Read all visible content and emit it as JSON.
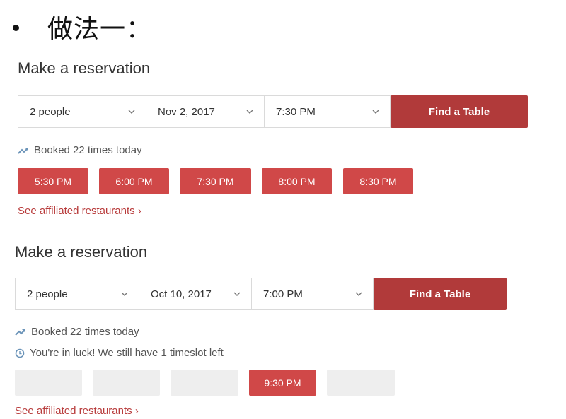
{
  "bullet": {
    "text": "做法一："
  },
  "sections": [
    {
      "heading": "Make a reservation",
      "people": "2 people",
      "date": "Nov 2, 2017",
      "time": "7:30 PM",
      "find_label": "Find a Table",
      "booked_text": "Booked 22 times today",
      "slots": [
        "5:30 PM",
        "6:00 PM",
        "7:30 PM",
        "8:00 PM",
        "8:30 PM"
      ],
      "affiliated_link": "See affiliated restaurants ›"
    },
    {
      "heading": "Make a reservation",
      "people": "2 people",
      "date": "Oct 10, 2017",
      "time": "7:00 PM",
      "find_label": "Find a Table",
      "booked_text": "Booked 22 times today",
      "luck_text": "You're in luck! We still have 1 timeslot left",
      "slots": [
        "",
        "",
        "",
        "9:30 PM",
        ""
      ],
      "affiliated_link": "See affiliated restaurants ›"
    }
  ],
  "icons": {
    "trend": "trending-up-icon",
    "clock": "clock-icon",
    "chevron": "chevron-down-icon"
  },
  "colors": {
    "find_button": "#b13a3a",
    "slot_available": "#d04848",
    "slot_unavailable": "#eeeeee",
    "link": "#b83b3b",
    "trend_icon": "#6a93b8"
  }
}
